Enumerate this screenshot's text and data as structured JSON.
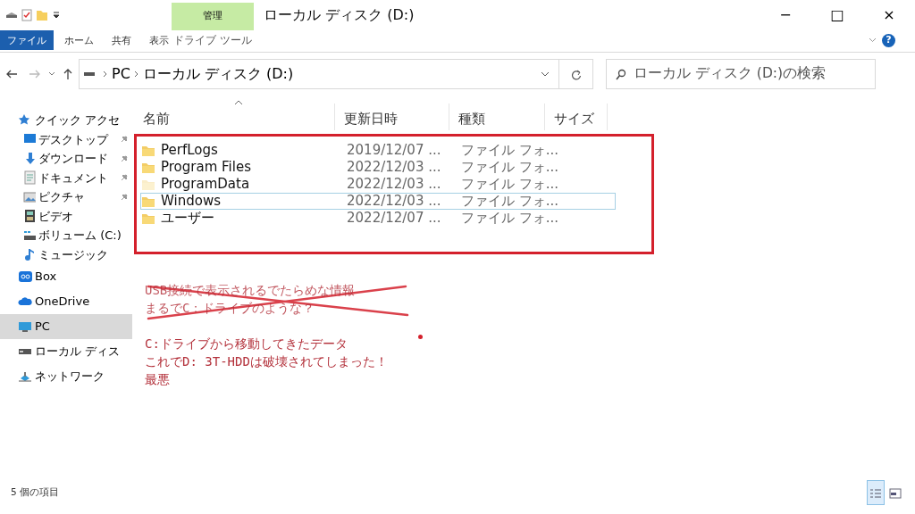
{
  "window": {
    "title": "ローカル ディスク (D:)",
    "context_group": "管理",
    "minimize": "−",
    "maximize": "□",
    "close": "×"
  },
  "ribbon": {
    "tabs": [
      {
        "label": "ファイル",
        "selected": true
      },
      {
        "label": "ホーム",
        "selected": false
      },
      {
        "label": "共有",
        "selected": false
      },
      {
        "label": "表示",
        "selected": false
      }
    ],
    "context_tab": "ドライブ ツール",
    "help": "?"
  },
  "address": {
    "crumbs": [
      "PC",
      "ローカル ディスク (D:)"
    ],
    "search": {
      "placeholder": "ローカル ディスク (D:)の検索"
    }
  },
  "sidebar": [
    {
      "label": "クイック アクセ",
      "selected": false,
      "children": [
        {
          "label": "デスクトップ",
          "pinned": true,
          "selected": false
        },
        {
          "label": "ダウンロード",
          "pinned": true,
          "selected": false
        },
        {
          "label": "ドキュメント",
          "pinned": true,
          "selected": false
        },
        {
          "label": "ピクチャ",
          "pinned": true,
          "selected": false
        },
        {
          "label": "ビデオ",
          "pinned": false,
          "selected": false
        },
        {
          "label": "ボリューム (C:)",
          "pinned": false,
          "selected": false
        },
        {
          "label": "ミュージック",
          "pinned": false,
          "selected": false
        }
      ]
    },
    {
      "label": "Box",
      "selected": false
    },
    {
      "label": "OneDrive",
      "selected": false
    },
    {
      "label": "PC",
      "selected": true
    },
    {
      "label": "ローカル ディス",
      "selected": false
    },
    {
      "label": "ネットワーク",
      "selected": false
    }
  ],
  "table": {
    "columns": [
      {
        "label": "名前",
        "sorted": true
      },
      {
        "label": "更新日時",
        "sorted": false
      },
      {
        "label": "種類",
        "sorted": false
      },
      {
        "label": "サイズ",
        "sorted": false
      }
    ],
    "rows": [
      {
        "name": "PerfLogs",
        "date": "2019/12/07 ...",
        "type": "ファイル フォ...",
        "hidden": false,
        "focused": false
      },
      {
        "name": "Program Files",
        "date": "2022/12/03 ...",
        "type": "ファイル フォ...",
        "hidden": false,
        "focused": false
      },
      {
        "name": "ProgramData",
        "date": "2022/12/03 ...",
        "type": "ファイル フォ...",
        "hidden": true,
        "focused": false
      },
      {
        "name": "Windows",
        "date": "2022/12/03 ...",
        "type": "ファイル フォ...",
        "hidden": false,
        "focused": true
      },
      {
        "name": "ユーザー",
        "date": "2022/12/07 ...",
        "type": "ファイル フォ...",
        "hidden": false,
        "focused": false
      }
    ]
  },
  "notes": [
    {
      "text": "USB接続で表示されるでたらめな情報",
      "struck": true
    },
    {
      "text": "まるでC：ドライブのような？",
      "struck": true
    },
    {
      "text": "C:ドライブから移動してきたデータ",
      "struck": false
    },
    {
      "text": "これでD: 3T-HDDは破壊されてしまった！",
      "struck": false
    },
    {
      "text": "最悪",
      "struck": false
    }
  ],
  "status_bar": {
    "item_count": "5 個の項目",
    "views": [
      {
        "selected": true
      },
      {
        "selected": false
      }
    ]
  }
}
